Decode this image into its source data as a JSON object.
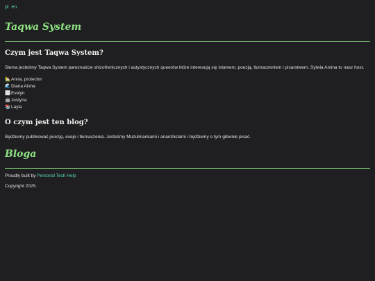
{
  "lang": [
    "pl",
    "en"
  ],
  "site_title": "Taqwa System",
  "section1": {
    "heading": "Czym jest Taqwa System?",
    "text": "Siema jesteśmy Taqwa System pareznaście shizofrenicznych i autystycznych queerów które interesują się Islamem, poezją, tłumaczeniem i pisarstwem. Sylwia Amina to nasz host.",
    "members": [
      {
        "emoji": "🏡",
        "name": "Anna, protector"
      },
      {
        "emoji": "🌊",
        "name": "Diana Aisha"
      },
      {
        "emoji": "⬜",
        "name": "Evelyn"
      },
      {
        "emoji": "🤖",
        "name": "Justyna"
      },
      {
        "emoji": "📚",
        "name": "Layla"
      }
    ]
  },
  "section2": {
    "heading": "O czym jest ten blog?",
    "text": "Będziemy publikować poezję, eseje i tłumaczenia. Jesteśmy Muzułmankami i anarchistami i będziemy o tym głównie pisać."
  },
  "blog_title": "Bloga",
  "footer": {
    "built_prefix": "Proudly built by",
    "built_link": "Personal Tech Help",
    "copyright": "Copyright 2025."
  }
}
